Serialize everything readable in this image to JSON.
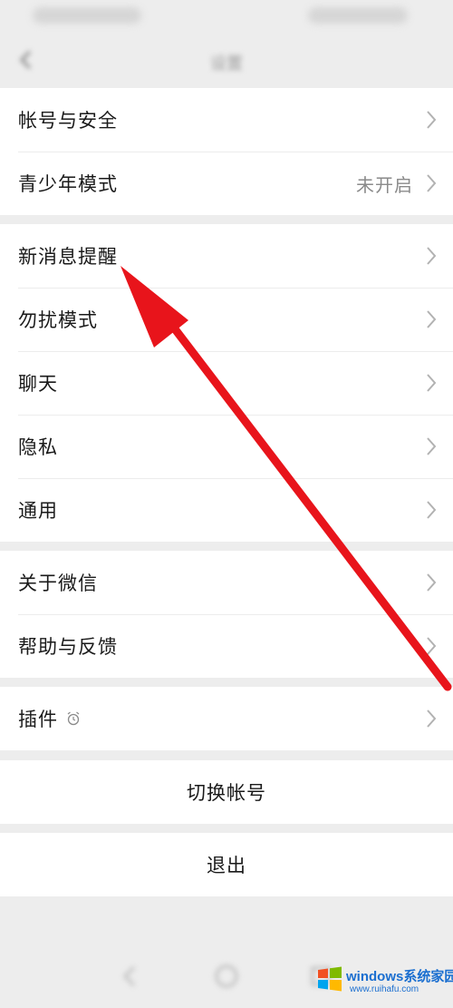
{
  "groups": [
    {
      "rows": [
        {
          "label": "帐号与安全",
          "value": ""
        },
        {
          "label": "青少年模式",
          "value": "未开启"
        }
      ]
    },
    {
      "rows": [
        {
          "label": "新消息提醒",
          "value": ""
        },
        {
          "label": "勿扰模式",
          "value": ""
        },
        {
          "label": "聊天",
          "value": ""
        },
        {
          "label": "隐私",
          "value": ""
        },
        {
          "label": "通用",
          "value": ""
        }
      ]
    },
    {
      "rows": [
        {
          "label": "关于微信",
          "value": ""
        },
        {
          "label": "帮助与反馈",
          "value": ""
        }
      ]
    },
    {
      "rows": [
        {
          "label": "插件",
          "value": ""
        }
      ]
    }
  ],
  "actions": {
    "switch_account": "切换帐号",
    "logout": "退出"
  },
  "watermark": {
    "brand": "windows系统家园",
    "domain": "www.ruihafu.com"
  },
  "colors": {
    "page_background": "#ededed",
    "annotation_arrow": "#e8141b"
  }
}
